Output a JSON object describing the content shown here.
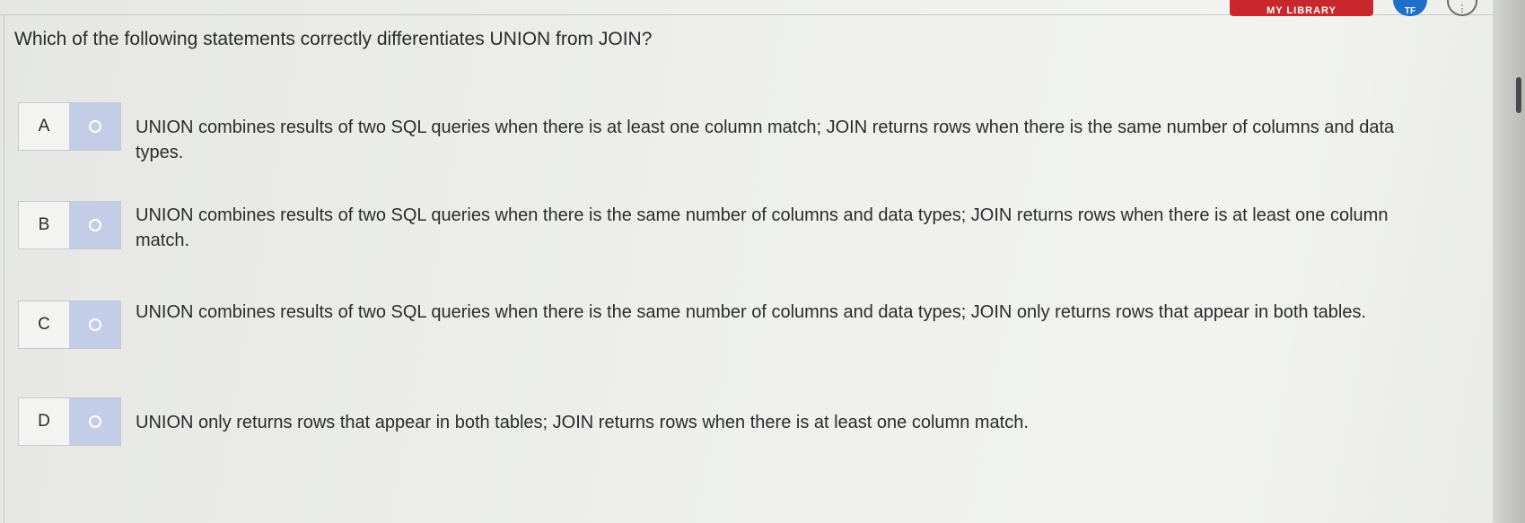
{
  "header": {
    "library_label": "MY LIBRARY",
    "avatar_initials": "TF",
    "menu_icon": "more-vertical-icon"
  },
  "question": {
    "text": "Which of the following statements correctly differentiates UNION from JOIN?"
  },
  "options": [
    {
      "letter": "A",
      "text": "UNION combines results of two SQL queries when there is at least one column match; JOIN returns rows when there is the same number of columns and data types."
    },
    {
      "letter": "B",
      "text": "UNION combines results of two SQL queries when there is the same number of columns and data types; JOIN returns rows when there is at least one column match."
    },
    {
      "letter": "C",
      "text": "UNION combines results of two SQL queries when there is the same number of columns and data types; JOIN only returns rows that appear in both tables."
    },
    {
      "letter": "D",
      "text": "UNION only returns rows that appear in both tables; JOIN returns rows when there is at least one column match."
    }
  ],
  "colors": {
    "radio_cell": "#c3cde8",
    "library_button": "#c8282d",
    "avatar": "#1e6fc7"
  }
}
